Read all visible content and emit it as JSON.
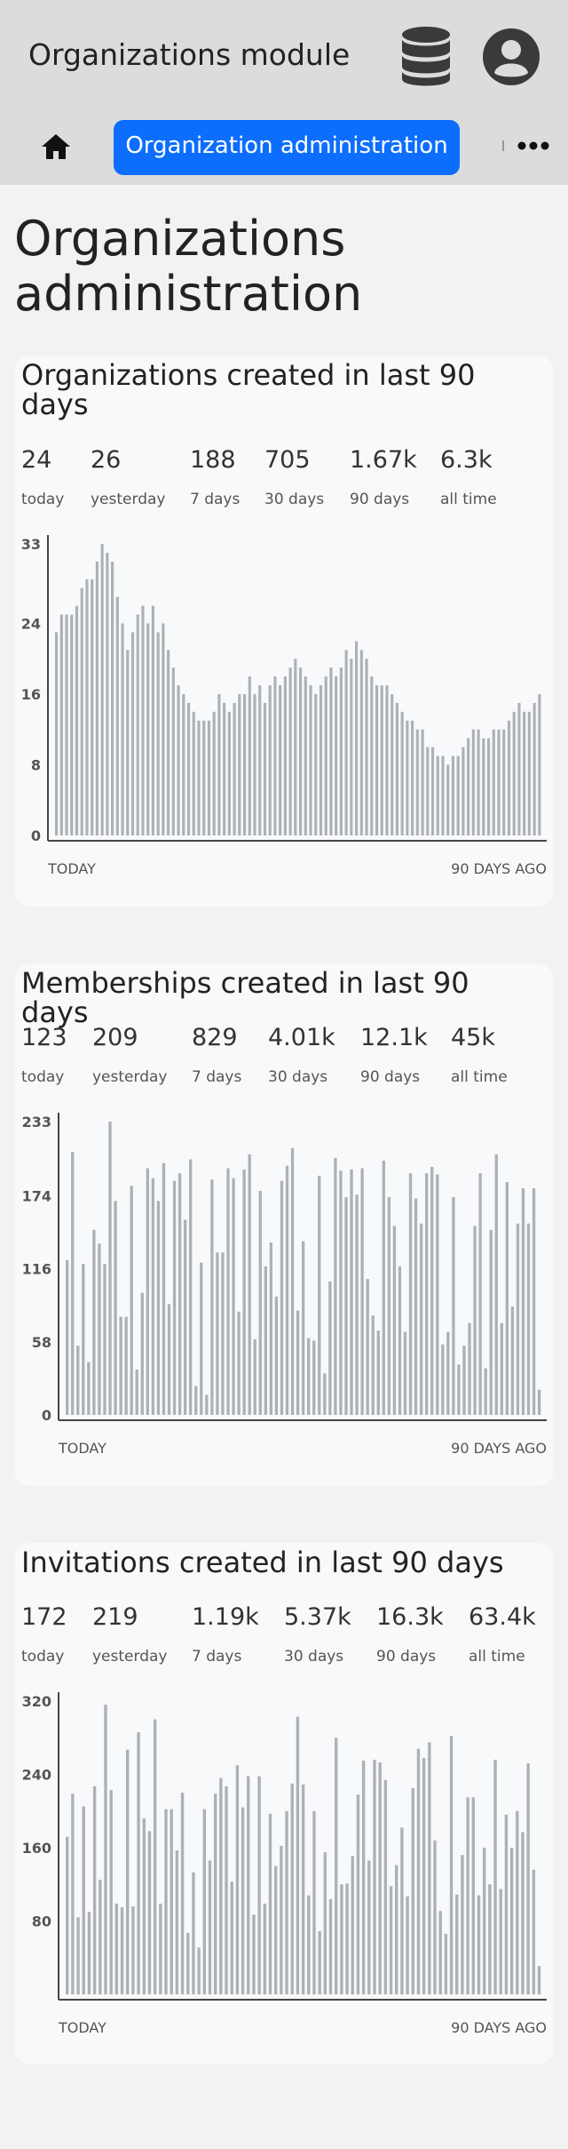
{
  "header": {
    "title": "Organizations module"
  },
  "nav": {
    "active_label": "Organization administration"
  },
  "page": {
    "title": "Organizations administration"
  },
  "colors": {
    "accent": "#0d6efd",
    "bar": "#aeb1b4",
    "header_bg": "#dcdcdc"
  },
  "icons": [
    "database-icon",
    "user-circle-icon",
    "home-icon",
    "more-dots-icon"
  ],
  "cards": [
    {
      "title": "Organizations created in last 90 days",
      "stats": [
        {
          "value": "24",
          "label": "today"
        },
        {
          "value": "26",
          "label": "yesterday"
        },
        {
          "value": "188",
          "label": "7 days"
        },
        {
          "value": "705",
          "label": "30 days"
        },
        {
          "value": "1.67k",
          "label": "90 days"
        },
        {
          "value": "6.3k",
          "label": "all time"
        }
      ],
      "xlabels": {
        "left": "TODAY",
        "right": "90 DAYS AGO"
      },
      "chart_data": {
        "type": "bar",
        "yticks": [
          "33",
          "24",
          "16",
          "8",
          "0"
        ],
        "ylim": [
          0,
          33
        ],
        "values": [
          23,
          25,
          25,
          25,
          26,
          28,
          29,
          29,
          31,
          33,
          32,
          31,
          27,
          24,
          21,
          23,
          25,
          26,
          24,
          26,
          23,
          24,
          21,
          19,
          17,
          16,
          15,
          14,
          13,
          13,
          13,
          14,
          16,
          15,
          14,
          15,
          16,
          16,
          18,
          16,
          17,
          15,
          17,
          18,
          17,
          18,
          19,
          20,
          19,
          18,
          17,
          16,
          17,
          18,
          19,
          18,
          19,
          21,
          20,
          22,
          21,
          20,
          18,
          17,
          17,
          17,
          16,
          15,
          14,
          13,
          13,
          12,
          12,
          10,
          10,
          9,
          9,
          8,
          9,
          9,
          10,
          11,
          12,
          12,
          11,
          11,
          12,
          12,
          12,
          13,
          14,
          15,
          14,
          14,
          15,
          16
        ]
      }
    },
    {
      "title": "Memberships created in last 90 days",
      "stats": [
        {
          "value": "123",
          "label": "today"
        },
        {
          "value": "209",
          "label": "yesterday"
        },
        {
          "value": "829",
          "label": "7 days"
        },
        {
          "value": "4.01k",
          "label": "30 days"
        },
        {
          "value": "12.1k",
          "label": "90 days"
        },
        {
          "value": "45k",
          "label": "all time"
        }
      ],
      "xlabels": {
        "left": "TODAY",
        "right": "90 DAYS AGO"
      },
      "chart_data": {
        "type": "bar",
        "yticks": [
          "233",
          "174",
          "116",
          "58",
          "0"
        ],
        "ylim": [
          0,
          233
        ],
        "values": [
          123,
          209,
          55,
          120,
          42,
          147,
          136,
          120,
          233,
          170,
          78,
          78,
          182,
          36,
          97,
          196,
          188,
          170,
          200,
          88,
          186,
          192,
          155,
          203,
          23,
          121,
          16,
          187,
          129,
          129,
          196,
          188,
          82,
          195,
          207,
          60,
          178,
          118,
          137,
          94,
          186,
          198,
          212,
          83,
          138,
          61,
          59,
          190,
          33,
          106,
          204,
          194,
          173,
          195,
          175,
          196,
          108,
          79,
          67,
          202,
          173,
          150,
          118,
          66,
          192,
          172,
          152,
          192,
          197,
          191,
          56,
          66,
          173,
          40,
          55,
          73,
          150,
          192,
          37,
          147,
          207,
          73,
          185,
          86,
          152,
          180,
          152,
          180,
          20
        ]
      }
    },
    {
      "title": "Invitations created in last 90 days",
      "stats": [
        {
          "value": "172",
          "label": "today"
        },
        {
          "value": "219",
          "label": "yesterday"
        },
        {
          "value": "1.19k",
          "label": "7 days"
        },
        {
          "value": "5.37k",
          "label": "30 days"
        },
        {
          "value": "16.3k",
          "label": "90 days"
        },
        {
          "value": "63.4k",
          "label": "all time"
        }
      ],
      "xlabels": {
        "left": "TODAY",
        "right": "90 DAYS AGO"
      },
      "chart_data": {
        "type": "bar",
        "yticks": [
          "320",
          "240",
          "160",
          "80"
        ],
        "ylim": [
          0,
          320
        ],
        "values": [
          172,
          219,
          84,
          205,
          90,
          227,
          125,
          316,
          223,
          99,
          95,
          267,
          96,
          286,
          192,
          178,
          300,
          99,
          202,
          202,
          157,
          220,
          67,
          133,
          51,
          202,
          146,
          219,
          236,
          227,
          123,
          250,
          204,
          238,
          87,
          238,
          99,
          197,
          140,
          162,
          200,
          230,
          303,
          229,
          108,
          200,
          69,
          155,
          104,
          280,
          120,
          121,
          151,
          218,
          255,
          146,
          256,
          253,
          234,
          118,
          141,
          182,
          107,
          225,
          268,
          258,
          275,
          168,
          91,
          66,
          282,
          109,
          152,
          215,
          215,
          108,
          160,
          120,
          256,
          115,
          196,
          160,
          200,
          177,
          252,
          136,
          31
        ]
      }
    }
  ]
}
